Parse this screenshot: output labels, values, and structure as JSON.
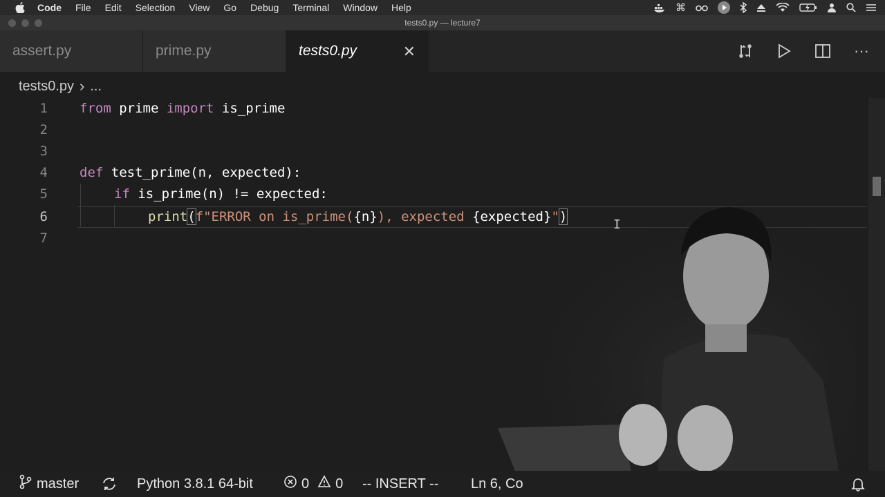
{
  "menubar": {
    "app": "Code",
    "items": [
      "File",
      "Edit",
      "Selection",
      "View",
      "Go",
      "Debug",
      "Terminal",
      "Window",
      "Help"
    ],
    "status_icons": [
      "docker-icon",
      "command-icon",
      "glasses-icon",
      "play-circle-icon",
      "bluetooth-icon",
      "eject-icon",
      "wifi-icon",
      "battery-icon",
      "user-icon",
      "search-icon",
      "list-icon"
    ]
  },
  "window": {
    "title": "tests0.py — lecture7"
  },
  "tabs": [
    {
      "label": "assert.py",
      "active": false
    },
    {
      "label": "prime.py",
      "active": false
    },
    {
      "label": "tests0.py",
      "active": true,
      "close": "✕"
    }
  ],
  "breadcrumb": {
    "file": "tests0.py",
    "separator": "›",
    "more": "..."
  },
  "editor": {
    "lines": [
      {
        "number": "1"
      },
      {
        "number": "2"
      },
      {
        "number": "3"
      },
      {
        "number": "4"
      },
      {
        "number": "5"
      },
      {
        "number": "6"
      },
      {
        "number": "7"
      }
    ],
    "code": {
      "l1_from": "from",
      "l1_module": " prime ",
      "l1_import": "import",
      "l1_name": " is_prime",
      "l4_def": "def",
      "l4_sig": " test_prime(n, expected):",
      "l5_if": "if",
      "l5_cond": " is_prime(n) != expected:",
      "l6_print": "print",
      "l6_open": "(",
      "l6_str1": "f\"ERROR on is_prime(",
      "l6_var1": "{n}",
      "l6_str2": "), expected ",
      "l6_var2": "{expected}",
      "l6_str3": "\"",
      "l6_close": ")"
    },
    "active_line": "6"
  },
  "statusbar": {
    "branch": "master",
    "python": "Python 3.8.1 64-bit",
    "errors": "0",
    "warnings": "0",
    "mode": "-- INSERT --",
    "position": "Ln 6, Co"
  },
  "colors": {
    "background": "#1e1e1e",
    "keyword": "#c586c0",
    "string": "#ce9178"
  }
}
